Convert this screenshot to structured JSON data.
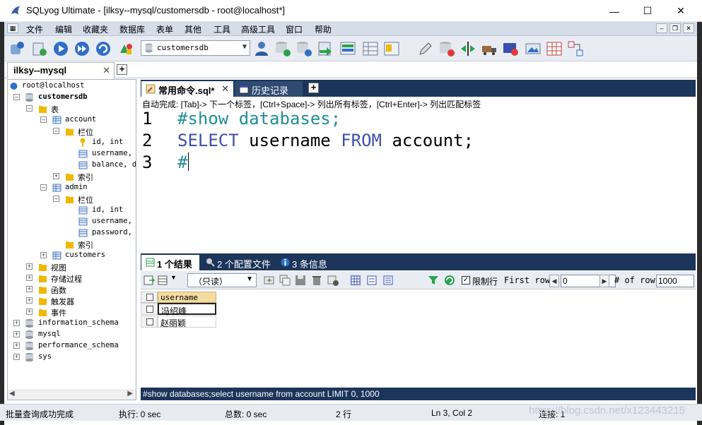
{
  "window": {
    "title": "SQLyog Ultimate - [ilksy--mysql/customersdb - root@localhost*]",
    "min": "—",
    "max": "☐",
    "close": "✕"
  },
  "menu": [
    "文件",
    "编辑",
    "收藏夹",
    "数据库",
    "表单",
    "其他",
    "工具",
    "高级工具",
    "窗口",
    "帮助"
  ],
  "toolbar": {
    "db_select": "customersdb"
  },
  "connection_tab": {
    "label": "ilksy--mysql",
    "close": "✕"
  },
  "tree": {
    "rows": [
      {
        "label": "root@localhost",
        "mono": true
      },
      {
        "label": "customersdb",
        "mono": true,
        "bold": true
      },
      {
        "label": "表"
      },
      {
        "label": "account",
        "mono": true
      },
      {
        "label": "栏位"
      },
      {
        "label": "id, int",
        "mono": true
      },
      {
        "label": "username, v",
        "mono": true
      },
      {
        "label": "balance, do",
        "mono": true
      },
      {
        "label": "索引"
      },
      {
        "label": "admin",
        "mono": true
      },
      {
        "label": "栏位"
      },
      {
        "label": "id, int",
        "mono": true
      },
      {
        "label": "username, v",
        "mono": true
      },
      {
        "label": "password, v",
        "mono": true
      },
      {
        "label": "索引"
      },
      {
        "label": "customers",
        "mono": true
      },
      {
        "label": "视图"
      },
      {
        "label": "存储过程"
      },
      {
        "label": "函数"
      },
      {
        "label": "触发器"
      },
      {
        "label": "事件"
      },
      {
        "label": "information_schema",
        "mono": true
      },
      {
        "label": "mysql",
        "mono": true
      },
      {
        "label": "performance_schema",
        "mono": true
      },
      {
        "label": "sys",
        "mono": true
      }
    ]
  },
  "query_tabs": {
    "active": "常用命令.sql*",
    "close": "✕",
    "history": "历史记录",
    "plus": "+"
  },
  "autocomplete_hint": "自动完成: [Tab]-> 下一个标签，[Ctrl+Space]-> 列出所有标签，[Ctrl+Enter]-> 列出匹配标签",
  "editor": {
    "line_numbers": [
      "1",
      "2",
      "3"
    ],
    "line1": "#show databases;",
    "line2_kw1": "SELECT",
    "line2_mid": " username ",
    "line2_kw2": "FROM",
    "line2_end": " account;",
    "line3": "#"
  },
  "result_tabs": [
    "1 个结果",
    "2 个配置文件",
    "3 条信息"
  ],
  "result_toolbar": {
    "mode": "（只读）",
    "limit_label": "限制行",
    "limit_checked": "✓",
    "first_row_label": "First row",
    "first_row_value": "0",
    "rows_label": "# of rows",
    "rows_value": "1000"
  },
  "grid": {
    "column": "username",
    "rows": [
      "冯绍峰",
      "赵丽颖"
    ]
  },
  "sql_status": "#show databases;select username from account LIMIT 0, 1000",
  "status": {
    "message": "批量查询成功完成",
    "exec": "执行: 0 sec",
    "total": "总数: 0 sec",
    "rows": "2 行",
    "pos": "Ln 3, Col 2",
    "conn": "连接: 1"
  },
  "watermark": "https://blog.csdn.net/x123443215",
  "colors": {
    "tab_dark": "#1c355a",
    "menubar": "#d4dde8",
    "keyword": "#3f4fa8",
    "comment": "#1f8f93",
    "header_cell": "#f4dca0"
  }
}
